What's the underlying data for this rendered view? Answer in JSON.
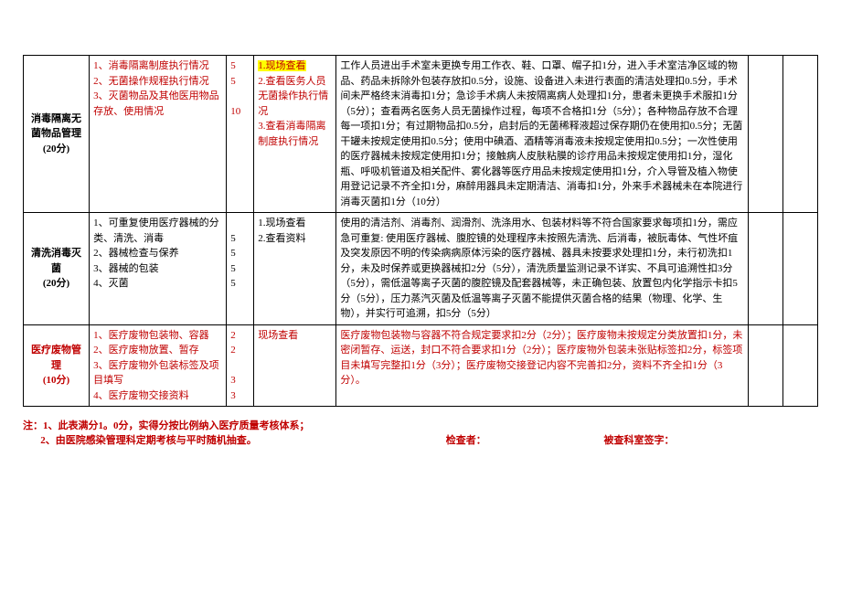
{
  "rows": [
    {
      "cat": "消毒隔离无菌物品管理<br>(20分)",
      "items": "1、消毒隔离制度执行情况<br>2、无菌操作规程执行情况<br>3、灭菌物品及其他医用物品存放、使用情况",
      "pts": "5<br>5<br><br>10",
      "method_hl": "1.现场查看",
      "method": "2.查看医务人员无菌操作执行情况<br>3.查看消毒隔离制度执行情况",
      "std": "工作人员进出手术室未更换专用工作衣、鞋、口罩、帽子扣1分，进入手术室洁净区域的物品、药品未拆除外包装存放扣0.5分，设施、设备进入未进行表面的清洁处理扣0.5分，手术间未严格终末消毒扣1分；急诊手术病人未按隔离病人处理扣1分，患者未更换手术服扣1分（5分）；查看两名医务人员无菌操作过程，每项不合格扣1分（5分）；各种物品存放不合理每一项扣1分；有过期物品扣0.5分，启封后的无菌稀释液超过保存期仍在使用扣0.5分；无菌干罐未按规定使用扣0.5分；使用中碘酒、酒精等消毒液未按规定使用扣0.5分；一次性使用的医疗器械未按规定使用扣1分；接触病人皮肤粘膜的诊疗用品未按规定使用扣1分，湿化瓶、呼吸机管道及相关配件、雾化器等医疗用品未按规定使用扣1分，介入导管及植入物使用登记记录不齐全扣1分，麻醉用器具未定期清洁、消毒扣1分，外来手术器械未在本院进行消毒灭菌扣1分（10分）",
      "items_red": true,
      "method_red": true
    },
    {
      "cat": "清洗消毒灭菌<br>(20分)",
      "items": "1、可重复使用医疗器械的分类、清洗、消毒<br>2、器械检查与保养<br>3、器械的包装<br>4、灭菌",
      "pts": "<br>5<br>5<br>5<br>5",
      "method": "1.现场查看<br>2.查看资料",
      "std": "使用的清洁剂、消毒剂、润滑剂、洗涤用水、包装材料等不符合国家要求每项扣1分，需应急可重复: 使用医疗器械、腹腔镜的处理程序未按照先清洗、后消毒，被朊毒体、气性坏疽及突发原因不明的传染病病原体污染的医疗器械、器具未按要求处理扣1分，未行初洗扣1分，未及时保养或更换器械扣2分（5分），清洗质量监测记录不详实、不具可追溯性扣3分（5分），需低温等离子灭菌的腹腔镜及配套器械等，未正确包装、放置包内化学指示卡扣5分（5分），压力蒸汽灭菌及低温等离子灭菌不能提供灭菌合格的结果（物理、化学、生物），并实行可追溯，扣5分（5分）"
    },
    {
      "cat": "医疗废物管理<br>(10分)",
      "items": "1、医疗废物包装物、容器<br>2、医疗废物放置、暂存<br>3、医疗废物外包装标签及项目填写<br>4、医疗废物交接资料",
      "pts": "2<br>2<br><br>3<br>3",
      "method": "现场查看",
      "std": "医疗废物包装物与容器不符合规定要求扣2分（2分）；医疗废物未按规定分类放置扣1分，未密闭暂存、运送，封口不符合要求扣1分（2分）；医疗废物外包装未张贴标签扣2分，标签项目未填写完整扣1分（3分）；医疗废物交接登记内容不完善扣2分，资料不齐全扣1分（3分）。",
      "items_red": true,
      "method_red": true,
      "std_red": true,
      "cat_red": true
    }
  ],
  "foot": {
    "note": "注：1、此表满分1。0分，实得分按比例纳入医疗质量考核体系；<br>&nbsp;&nbsp;&nbsp;&nbsp;&nbsp;&nbsp;&nbsp;2、由医院感染管理科定期考核与平时随机抽查。",
    "checker": "检查者：",
    "dept": "被查科室签字："
  }
}
